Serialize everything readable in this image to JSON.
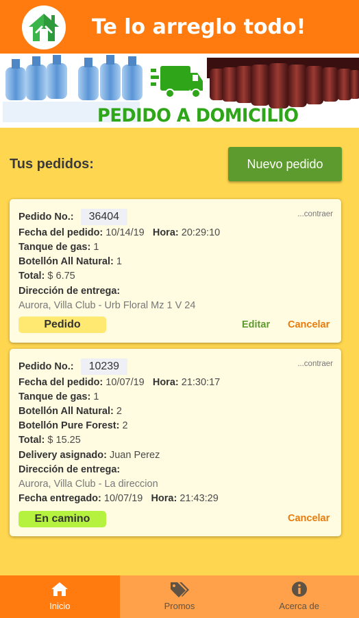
{
  "app": {
    "title": "Te lo arreglo todo!"
  },
  "banner": {
    "text": "PEDIDO A DOMICILIO"
  },
  "orders_header": {
    "label": "Tus pedidos:",
    "new_button": "Nuevo pedido"
  },
  "orders": [
    {
      "no_label": "Pedido No.:",
      "no_value": "36404",
      "collapse": "...contraer",
      "date_label": "Fecha del pedido:",
      "date": "10/14/19",
      "time_label": "Hora:",
      "time": "20:29:10",
      "items": [
        {
          "label": "Tanque de gas:",
          "value": "1"
        },
        {
          "label": "Botellón All Natural:",
          "value": "1"
        }
      ],
      "total_label": "Total:",
      "total": "$ 6.75",
      "address_label": "Dirección de entrega:",
      "address": "Aurora, Villa Club - Urb Floral Mz 1 V 24",
      "status": "Pedido",
      "edit": "Editar",
      "cancel": "Cancelar"
    },
    {
      "no_label": "Pedido No.:",
      "no_value": "10239",
      "collapse": "...contraer",
      "date_label": "Fecha del pedido:",
      "date": "10/07/19",
      "time_label": "Hora:",
      "time": "21:30:17",
      "items": [
        {
          "label": "Tanque de gas:",
          "value": "1"
        },
        {
          "label": "Botellón All Natural:",
          "value": "2"
        },
        {
          "label": "Botellón Pure Forest:",
          "value": "2"
        }
      ],
      "total_label": "Total:",
      "total": "$ 15.25",
      "delivery_label": "Delivery asignado:",
      "delivery": "Juan Perez",
      "address_label": "Dirección de entrega:",
      "address": "Aurora, Villa Club - La direccion",
      "delivered_label": "Fecha entregado:",
      "delivered_date": "10/07/19",
      "delivered_time_label": "Hora:",
      "delivered_time": "21:43:29",
      "status": "En camino",
      "cancel": "Cancelar"
    }
  ],
  "nav": [
    {
      "label": "Inicio",
      "icon": "home-icon"
    },
    {
      "label": "Promos",
      "icon": "tags-icon"
    },
    {
      "label": "Acerca de",
      "icon": "info-icon"
    }
  ],
  "colors": {
    "primary": "#ff7b0f",
    "background": "#ffd64f",
    "accent_green": "#5e9b2f",
    "card": "#fffce2",
    "status_pedido": "#ffe970",
    "status_en_camino": "#b4f23f"
  }
}
